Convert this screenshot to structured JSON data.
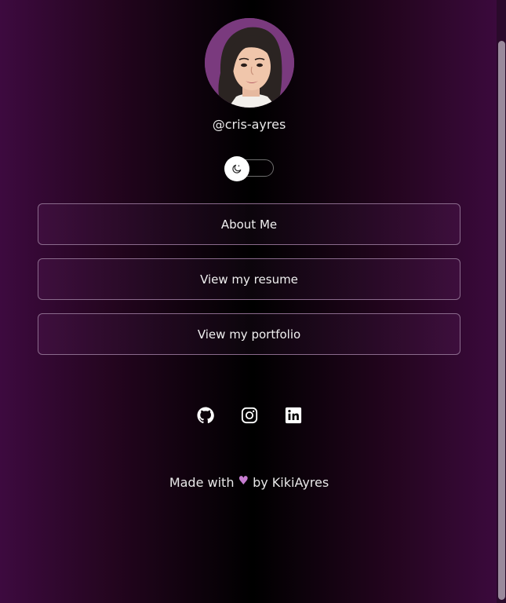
{
  "profile": {
    "username": "@cris-ayres",
    "avatar_icon": "avatar-illustration"
  },
  "theme_toggle": {
    "icon": "moon-icon",
    "state": "dark"
  },
  "links": [
    {
      "label": "About Me"
    },
    {
      "label": "View my resume"
    },
    {
      "label": "View my portfolio"
    }
  ],
  "social": [
    {
      "icon": "github-icon"
    },
    {
      "icon": "instagram-icon"
    },
    {
      "icon": "linkedin-icon"
    }
  ],
  "footer": {
    "prefix": "Made with",
    "heart": "♥",
    "suffix": "by KikiAyres"
  },
  "colors": {
    "background_edge": "#3d0a3f",
    "background_center": "#000000",
    "button_border": "#8a6a8c",
    "heart": "#c77dd1"
  }
}
